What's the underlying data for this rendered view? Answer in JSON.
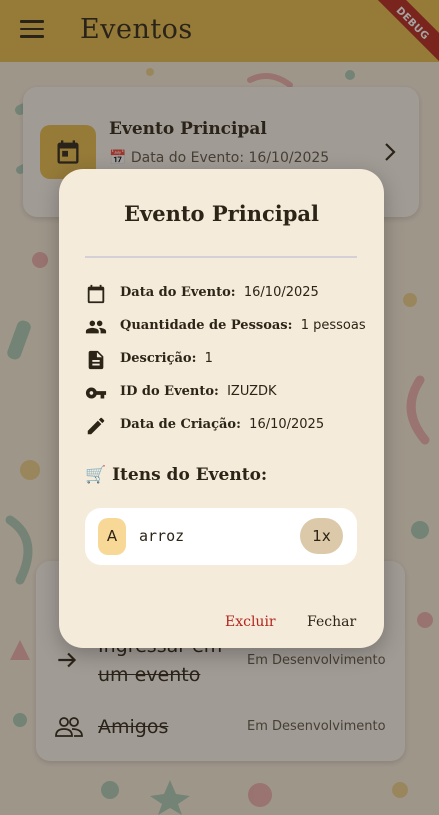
{
  "appbar": {
    "title": "Eventos",
    "debug_label": "DEBUG"
  },
  "event_card": {
    "title": "Evento Principal",
    "date_label": "📅 Data do Evento: 16/10/2025"
  },
  "menu": {
    "items": [
      {
        "label": "Ingressar em um evento",
        "status": "Em Desenvolvimento"
      },
      {
        "label": "Amigos",
        "status": "Em Desenvolvimento"
      }
    ]
  },
  "dialog": {
    "title": "Evento Principal",
    "info": [
      {
        "icon": "calendar-icon",
        "label": "Data do Evento:",
        "value": "16/10/2025"
      },
      {
        "icon": "people-icon",
        "label": "Quantidade de Pessoas:",
        "value": "1 pessoas"
      },
      {
        "icon": "document-icon",
        "label": "Descrição:",
        "value": "1"
      },
      {
        "icon": "key-icon",
        "label": "ID do Evento:",
        "value": "IZUZDK"
      },
      {
        "icon": "pencil-icon",
        "label": "Data de Criação:",
        "value": "16/10/2025"
      }
    ],
    "items_title": "🛒 Itens do Evento:",
    "items": [
      {
        "initial": "A",
        "name": "arroz",
        "quantity": "1x"
      }
    ],
    "delete_label": "Excluir",
    "close_label": "Fechar"
  },
  "colors": {
    "appbar": "#e3b84a",
    "background": "#f4e9d8",
    "dialog": "#f5ebdb",
    "danger": "#b3261e",
    "chip": "#dcc9a9",
    "avatar": "#f7d897"
  }
}
